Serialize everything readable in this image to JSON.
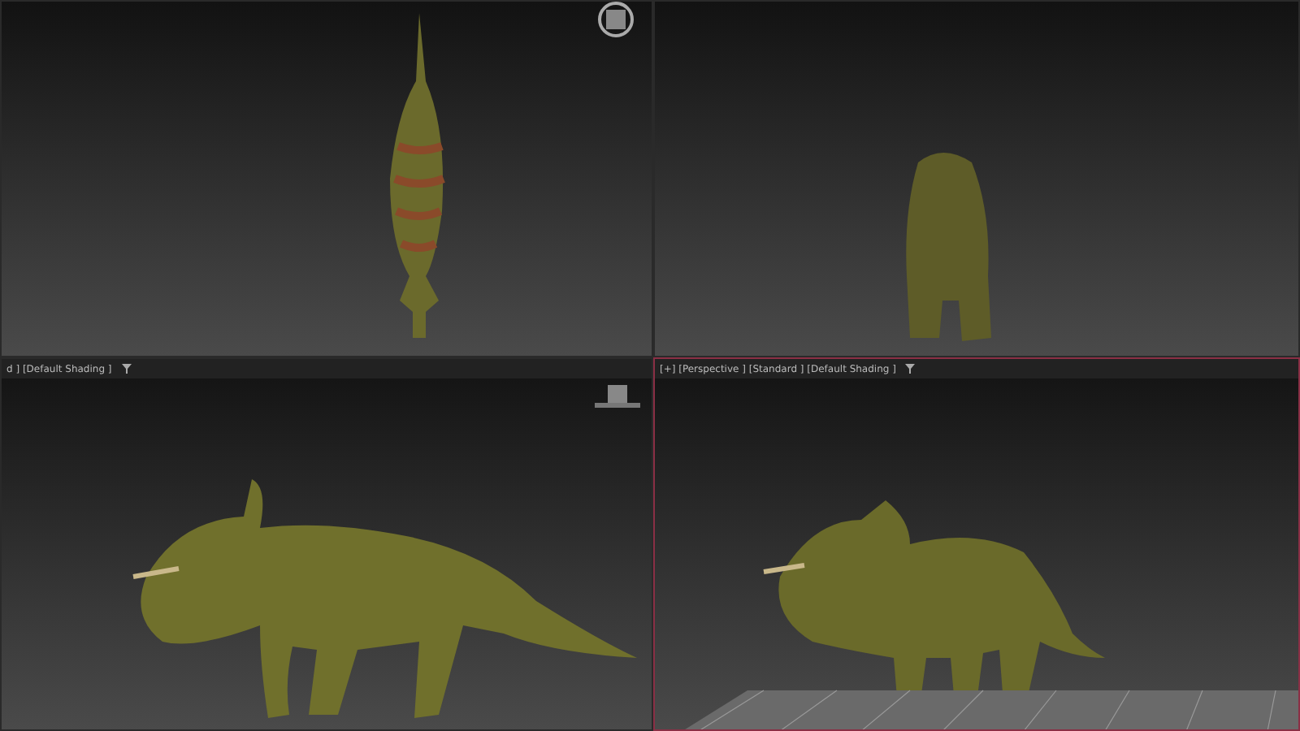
{
  "viewports": [
    {
      "kind": "top",
      "active": false
    },
    {
      "kind": "back",
      "active": false
    },
    {
      "kind": "side",
      "label": "d ] [Default Shading ]",
      "active": false
    },
    {
      "kind": "perspective",
      "label": "[+] [Perspective ] [Standard ] [Default Shading ]",
      "active": true
    }
  ]
}
